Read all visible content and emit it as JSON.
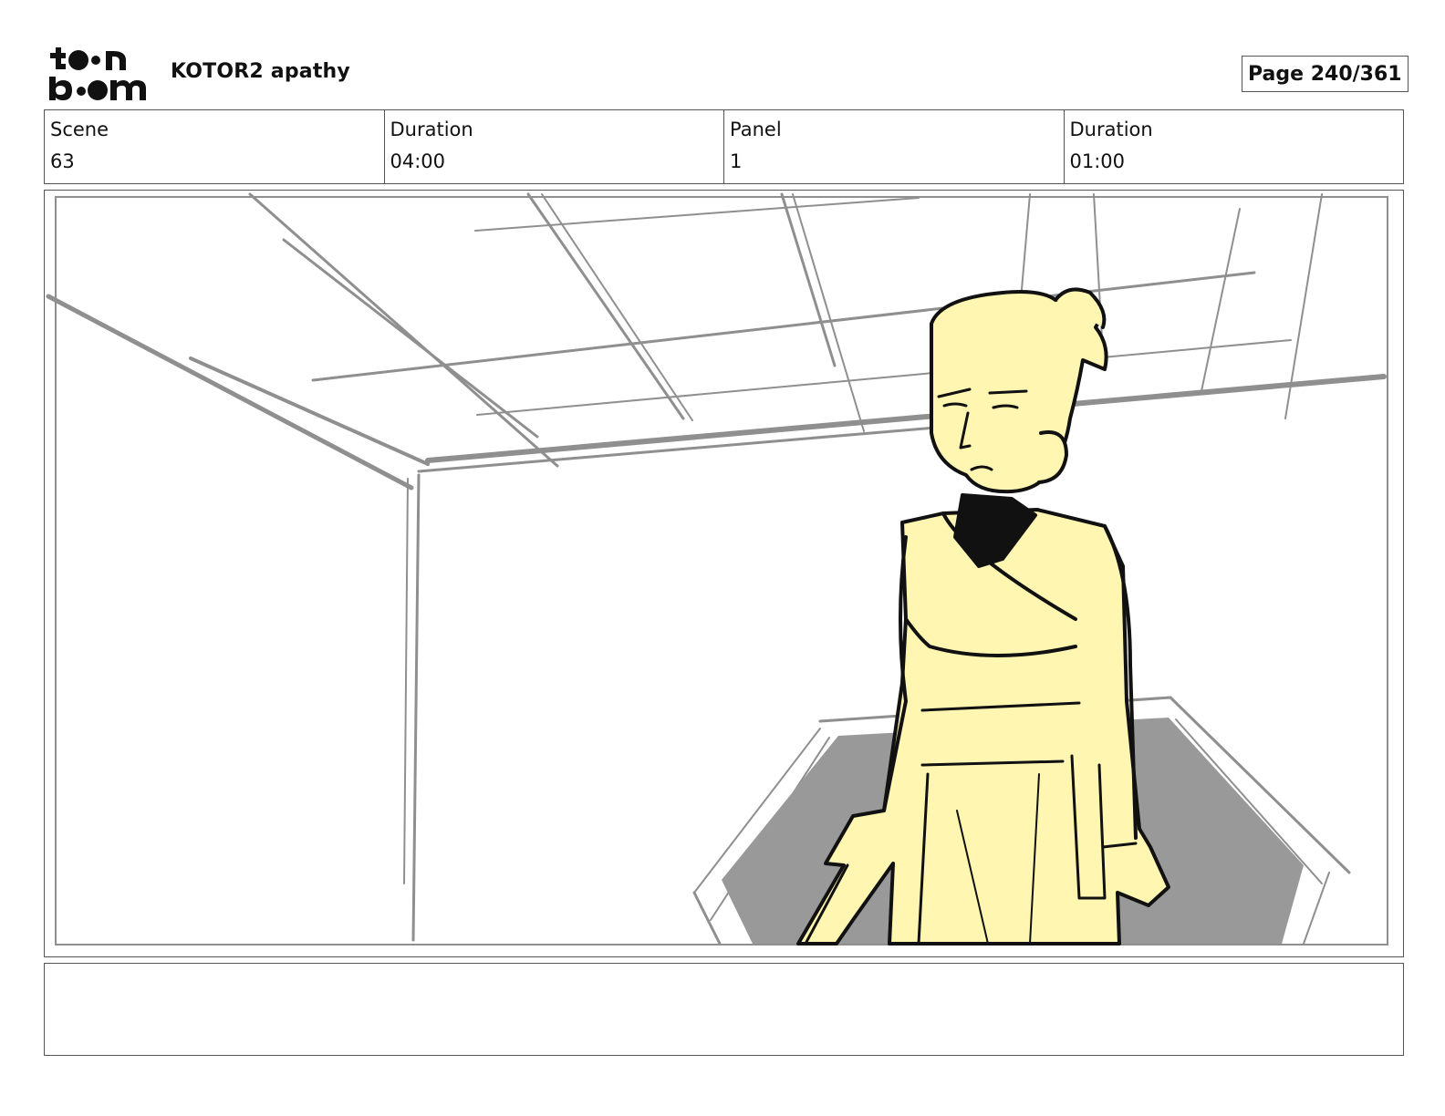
{
  "header": {
    "logo_text": "toon boom",
    "project_title": "KOTOR2 apathy",
    "page_counter": "Page 240/361"
  },
  "info": {
    "scene_label": "Scene",
    "scene_value": "63",
    "scene_duration_label": "Duration",
    "scene_duration_value": "04:00",
    "panel_label": "Panel",
    "panel_value": "1",
    "panel_duration_label": "Duration",
    "panel_duration_value": "01:00"
  },
  "panel": {
    "character_fill": "#fff6b2",
    "line_color": "#111111",
    "set_line_color": "#8f8f8f",
    "floor_shadow": "#999999"
  },
  "caption": {}
}
